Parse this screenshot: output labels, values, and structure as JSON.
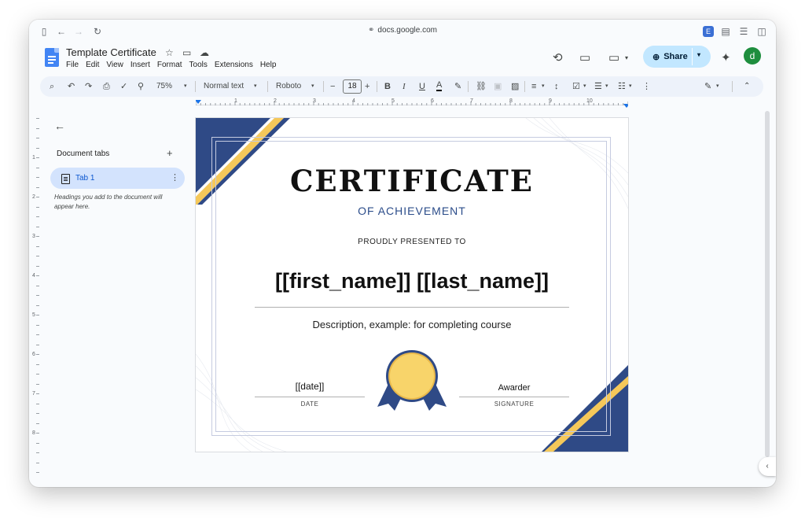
{
  "browser": {
    "url": "docs.google.com"
  },
  "doc": {
    "title": "Template Certificate",
    "menu": [
      "File",
      "Edit",
      "View",
      "Insert",
      "Format",
      "Tools",
      "Extensions",
      "Help"
    ],
    "share_label": "Share",
    "avatar_letter": "d"
  },
  "toolbar": {
    "zoom": "75%",
    "style": "Normal text",
    "font": "Roboto",
    "font_size": "18",
    "bold": "B",
    "italic": "I",
    "underline": "U",
    "text_color": "A"
  },
  "ruler": {
    "h_numbers": [
      "1",
      "2",
      "3",
      "4",
      "5",
      "6",
      "7",
      "8",
      "9",
      "10"
    ],
    "v_numbers": [
      "1",
      "2",
      "3",
      "4",
      "5",
      "6",
      "7",
      "8"
    ]
  },
  "sidebar": {
    "heading": "Document tabs",
    "tab_label": "Tab 1",
    "hint": "Headings you add to the document will appear here."
  },
  "certificate": {
    "title": "CERTIFICATE",
    "subtitle": "OF ACHIEVEMENT",
    "presented": "PROUDLY PRESENTED TO",
    "recipient": "[[first_name]] [[last_name]]",
    "description": "Description, example: for completing course",
    "date_value": "[[date]]",
    "date_label": "DATE",
    "awarder_value": "Awarder",
    "signature_label": "SIGNATURE"
  },
  "colors": {
    "navy": "#2f4a86",
    "gold": "#f5c85a",
    "share_bg": "#c2e7ff",
    "tab_bg": "#d3e3fd",
    "avatar": "#1e8e3e"
  }
}
